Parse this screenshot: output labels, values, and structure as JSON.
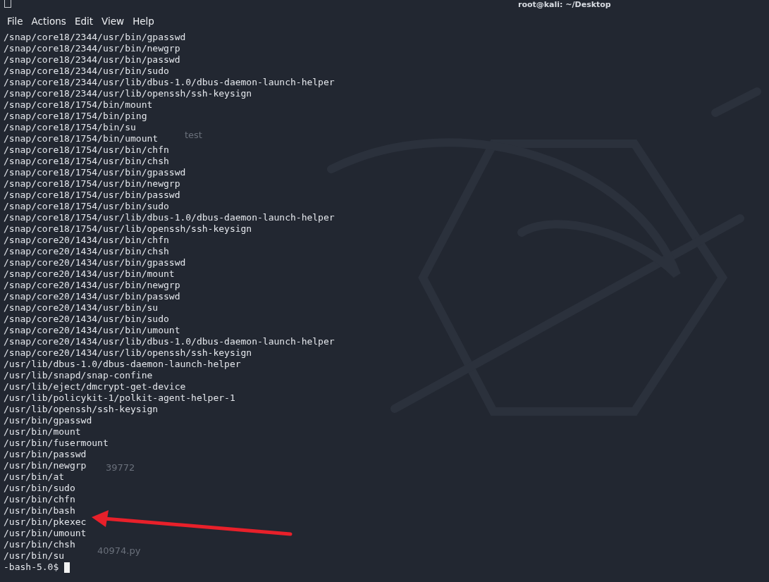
{
  "window": {
    "title": "root@kali: ~/Desktop"
  },
  "menu": [
    "File",
    "Actions",
    "Edit",
    "View",
    "Help"
  ],
  "desktop_labels": [
    {
      "text": "test",
      "kind": "upper"
    },
    {
      "text": "39772",
      "kind": "middle"
    },
    {
      "text": "40974.py",
      "kind": "lower"
    }
  ],
  "terminal": {
    "lines": [
      "/snap/core18/2344/usr/bin/gpasswd",
      "/snap/core18/2344/usr/bin/newgrp",
      "/snap/core18/2344/usr/bin/passwd",
      "/snap/core18/2344/usr/bin/sudo",
      "/snap/core18/2344/usr/lib/dbus-1.0/dbus-daemon-launch-helper",
      "/snap/core18/2344/usr/lib/openssh/ssh-keysign",
      "/snap/core18/1754/bin/mount",
      "/snap/core18/1754/bin/ping",
      "/snap/core18/1754/bin/su",
      "/snap/core18/1754/bin/umount",
      "/snap/core18/1754/usr/bin/chfn",
      "/snap/core18/1754/usr/bin/chsh",
      "/snap/core18/1754/usr/bin/gpasswd",
      "/snap/core18/1754/usr/bin/newgrp",
      "/snap/core18/1754/usr/bin/passwd",
      "/snap/core18/1754/usr/bin/sudo",
      "/snap/core18/1754/usr/lib/dbus-1.0/dbus-daemon-launch-helper",
      "/snap/core18/1754/usr/lib/openssh/ssh-keysign",
      "/snap/core20/1434/usr/bin/chfn",
      "/snap/core20/1434/usr/bin/chsh",
      "/snap/core20/1434/usr/bin/gpasswd",
      "/snap/core20/1434/usr/bin/mount",
      "/snap/core20/1434/usr/bin/newgrp",
      "/snap/core20/1434/usr/bin/passwd",
      "/snap/core20/1434/usr/bin/su",
      "/snap/core20/1434/usr/bin/sudo",
      "/snap/core20/1434/usr/bin/umount",
      "/snap/core20/1434/usr/lib/dbus-1.0/dbus-daemon-launch-helper",
      "/snap/core20/1434/usr/lib/openssh/ssh-keysign",
      "/usr/lib/dbus-1.0/dbus-daemon-launch-helper",
      "/usr/lib/snapd/snap-confine",
      "/usr/lib/eject/dmcrypt-get-device",
      "/usr/lib/policykit-1/polkit-agent-helper-1",
      "/usr/lib/openssh/ssh-keysign",
      "/usr/bin/gpasswd",
      "/usr/bin/mount",
      "/usr/bin/fusermount",
      "/usr/bin/passwd",
      "/usr/bin/newgrp",
      "/usr/bin/at",
      "/usr/bin/sudo",
      "/usr/bin/chfn",
      "/usr/bin/bash",
      "/usr/bin/pkexec",
      "/usr/bin/umount",
      "/usr/bin/chsh",
      "/usr/bin/su"
    ],
    "prompt": "-bash-5.0$"
  }
}
